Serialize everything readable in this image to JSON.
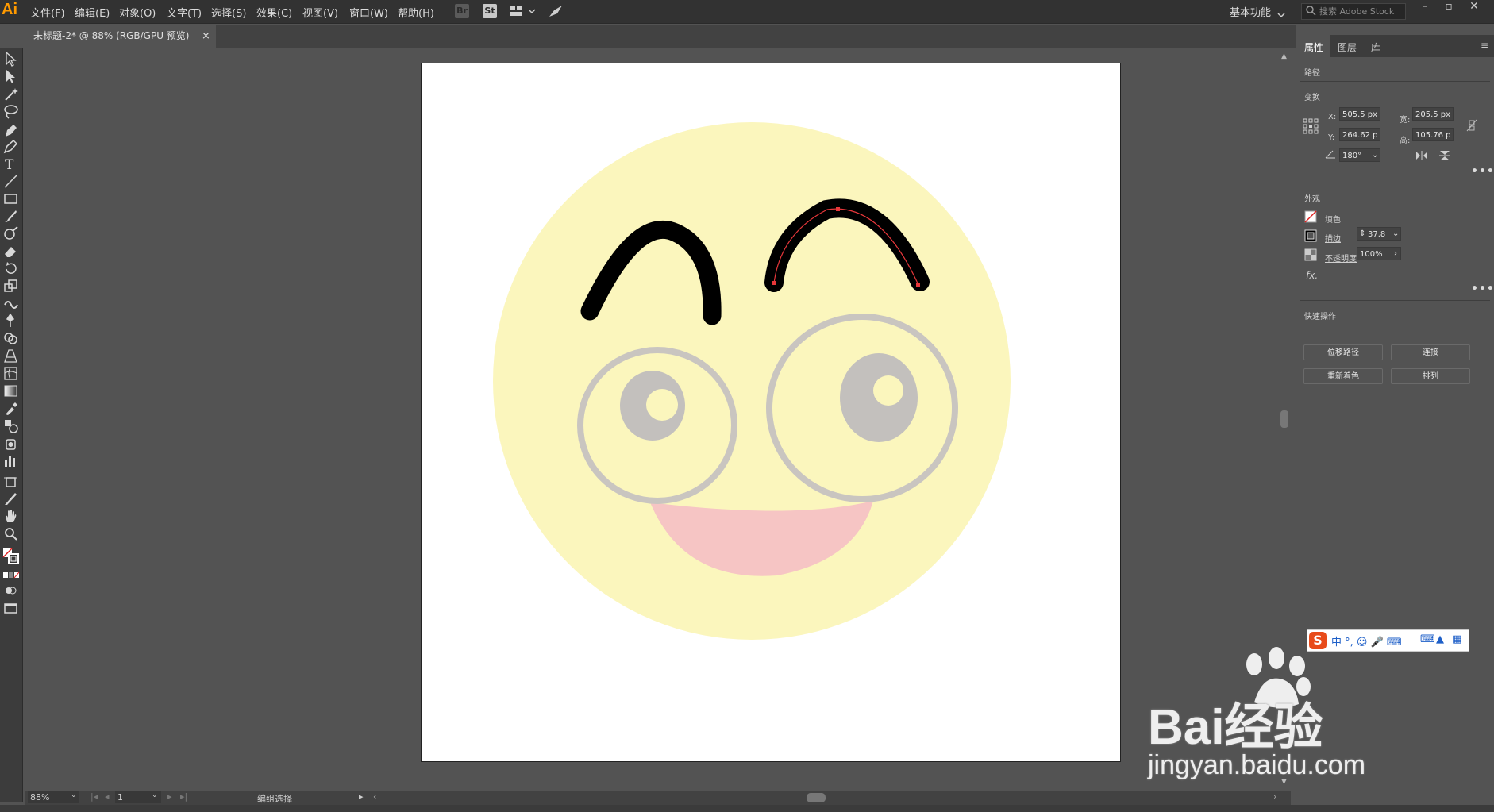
{
  "app": {
    "logo": "Ai",
    "workspace": "基本功能",
    "search_placeholder": "搜索 Adobe Stock"
  },
  "menu": [
    "文件(F)",
    "编辑(E)",
    "对象(O)",
    "文字(T)",
    "选择(S)",
    "效果(C)",
    "视图(V)",
    "窗口(W)",
    "帮助(H)"
  ],
  "toolbar_icons": [
    "Br",
    "St"
  ],
  "document": {
    "tab_title": "未标题-2* @ 88% (RGB/GPU 预览)",
    "close": "×"
  },
  "status": {
    "zoom": "88%",
    "page": "1",
    "tool_status": "编组选择"
  },
  "panel": {
    "tabs": [
      "属性",
      "图层",
      "库"
    ],
    "object_type": "路径",
    "transform": {
      "title": "变换",
      "x_label": "X:",
      "x": "505.5 px",
      "y_label": "Y:",
      "y": "264.62 p",
      "w_label": "宽:",
      "w": "205.5 px",
      "h_label": "高:",
      "h": "105.76 p",
      "angle": "180°"
    },
    "appearance": {
      "title": "外观",
      "fill_label": "填色",
      "stroke_label": "描边",
      "stroke_value": "37.8",
      "opacity_label": "不透明度",
      "opacity_value": "100%",
      "fx_label": "fx."
    },
    "quick_actions": {
      "title": "快速操作",
      "offset_path": "位移路径",
      "join": "连接",
      "recolor": "重新着色",
      "arrange": "排列"
    }
  },
  "ime_bar": "中 °, ☺ 🎤 ⌨",
  "watermark": {
    "brand": "Bai经验",
    "url": "jingyan.baidu.com"
  },
  "colors": {
    "face": "#fbf6bd",
    "eye_ring": "#c9c5c0",
    "pupil": "#c3c0bd",
    "mouth": "#f6c5c4",
    "brow": "#000000",
    "selection": "#e8373a"
  }
}
